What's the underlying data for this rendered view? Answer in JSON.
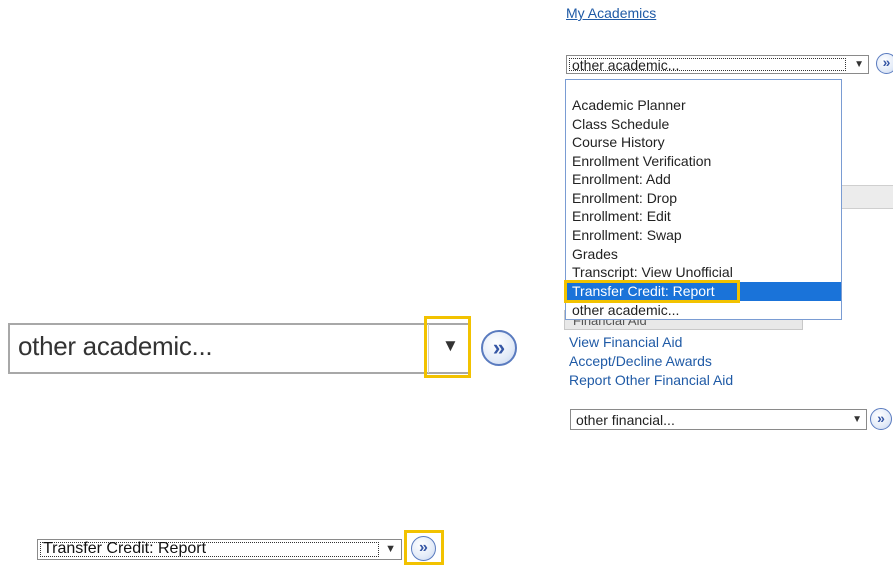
{
  "academics": {
    "heading": "My Academics",
    "select_value": "other academic...",
    "options": [
      "Academic Planner",
      "Class Schedule",
      "Course History",
      "Enrollment Verification",
      "Enrollment: Add",
      "Enrollment: Drop",
      "Enrollment: Edit",
      "Enrollment: Swap",
      "Grades",
      "Transcript: View Unofficial",
      "Transfer Credit: Report",
      "other academic..."
    ],
    "highlighted_option": "Transfer Credit: Report"
  },
  "financial": {
    "section_label": "Financial Aid",
    "links": [
      "View Financial Aid",
      "Accept/Decline Awards",
      "Report Other Financial Aid"
    ],
    "select_value": "other financial..."
  },
  "zoom_select": {
    "value": "other academic..."
  },
  "bottom_select": {
    "value": "Transfer Credit: Report"
  },
  "icons": {
    "dropdown_arrow": "▼",
    "go_button": "»"
  },
  "colors": {
    "link": "#1f5aa6",
    "highlight": "#1a73d9",
    "callout": "#f2c200"
  }
}
